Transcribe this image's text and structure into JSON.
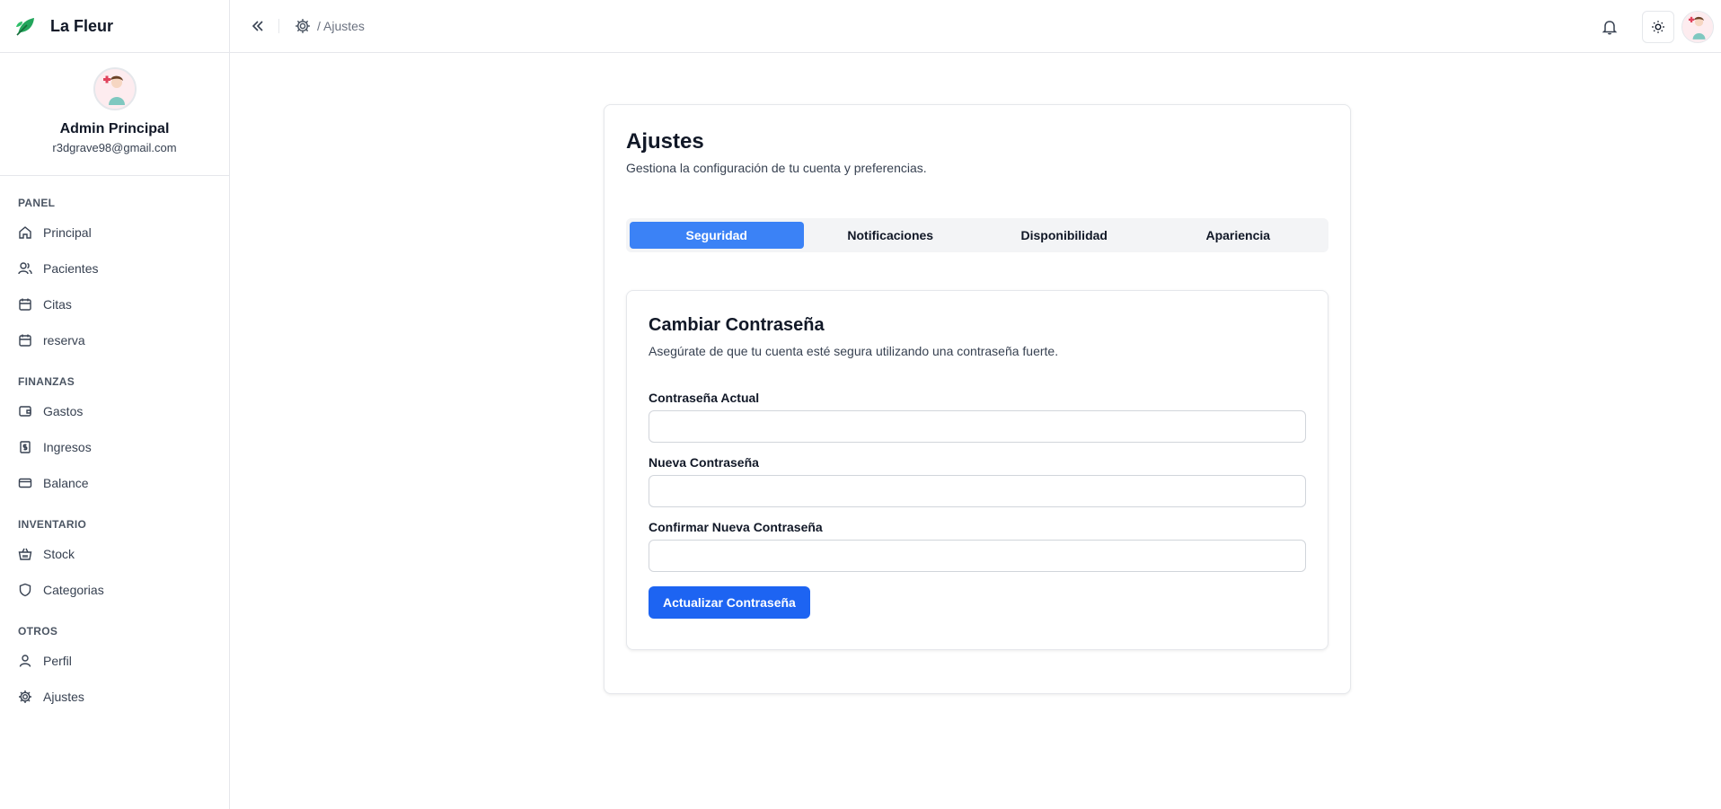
{
  "brand": {
    "name": "La Fleur",
    "accent": "#22a55b"
  },
  "user": {
    "name": "Admin Principal",
    "email": "r3dgrave98@gmail.com"
  },
  "sidebar": {
    "sections": [
      {
        "title": "PANEL",
        "items": [
          {
            "label": "Principal",
            "icon": "home-icon"
          },
          {
            "label": "Pacientes",
            "icon": "users-icon"
          },
          {
            "label": "Citas",
            "icon": "calendar-icon"
          },
          {
            "label": "reserva",
            "icon": "calendar-icon"
          }
        ]
      },
      {
        "title": "FINANZAS",
        "items": [
          {
            "label": "Gastos",
            "icon": "wallet-icon"
          },
          {
            "label": "Ingresos",
            "icon": "receipt-icon"
          },
          {
            "label": "Balance",
            "icon": "credit-card-icon"
          }
        ]
      },
      {
        "title": "INVENTARIO",
        "items": [
          {
            "label": "Stock",
            "icon": "basket-icon"
          },
          {
            "label": "Categorias",
            "icon": "shield-icon"
          }
        ]
      },
      {
        "title": "OTROS",
        "items": [
          {
            "label": "Perfil",
            "icon": "user-icon"
          },
          {
            "label": "Ajustes",
            "icon": "gear-icon"
          }
        ]
      }
    ]
  },
  "header": {
    "breadcrumb": "/ Ajustes"
  },
  "settings": {
    "title": "Ajustes",
    "subtitle": "Gestiona la configuración de tu cuenta y preferencias.",
    "tabs": [
      "Seguridad",
      "Notificaciones",
      "Disponibilidad",
      "Apariencia"
    ],
    "active_tab": "Seguridad",
    "password": {
      "title": "Cambiar Contraseña",
      "subtitle": "Asegúrate de que tu cuenta esté segura utilizando una contraseña fuerte.",
      "current_label": "Contraseña Actual",
      "current_value": "",
      "new_label": "Nueva Contraseña",
      "new_value": "",
      "confirm_label": "Confirmar Nueva Contraseña",
      "confirm_value": "",
      "submit_label": "Actualizar Contraseña"
    }
  },
  "colors": {
    "primary": "#1d64f2",
    "tab_active": "#3b82f6"
  }
}
